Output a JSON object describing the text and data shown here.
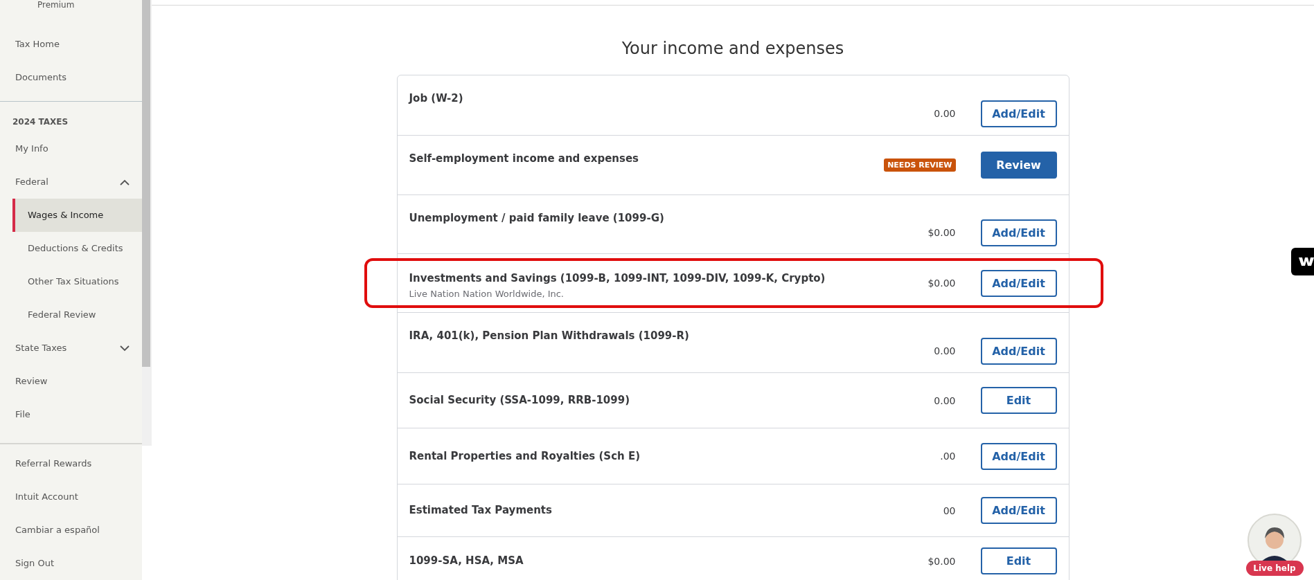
{
  "sidebar": {
    "plan": "Premium",
    "top_items": [
      {
        "label": "Tax Home",
        "selected": false
      },
      {
        "label": "Documents",
        "selected": false
      }
    ],
    "section_heading": "2024 TAXES",
    "items": [
      {
        "label": "My Info",
        "selected": false
      },
      {
        "label": "Federal",
        "selected": false,
        "expanded": true,
        "children": [
          {
            "label": "Wages & Income",
            "selected": true
          },
          {
            "label": "Deductions & Credits",
            "selected": false
          },
          {
            "label": "Other Tax Situations",
            "selected": false
          },
          {
            "label": "Federal Review",
            "selected": false
          }
        ]
      },
      {
        "label": "State Taxes",
        "selected": false,
        "expanded": false
      },
      {
        "label": "Review",
        "selected": false
      },
      {
        "label": "File",
        "selected": false
      }
    ],
    "footer_items": [
      {
        "label": "Referral Rewards"
      },
      {
        "label": "Intuit Account"
      },
      {
        "label": "Cambiar a español"
      },
      {
        "label": "Sign Out"
      }
    ]
  },
  "page_title": "Your income and expenses",
  "rows": [
    {
      "title": "Job (W-2)",
      "amount": "0.00",
      "button": {
        "label": "Add/Edit",
        "kind": "outline"
      }
    },
    {
      "title": "Self-employment income and expenses",
      "badge": "NEEDS REVIEW",
      "button": {
        "label": "Review",
        "kind": "primary"
      }
    },
    {
      "title": "Unemployment / paid family leave (1099-G)",
      "amount": "$0.00",
      "button": {
        "label": "Add/Edit",
        "kind": "outline"
      }
    },
    {
      "title": "Investments and Savings (1099-B, 1099-INT, 1099-DIV, 1099-K, Crypto)",
      "subtitle": "Live Nation Nation Worldwide, Inc.",
      "amount": "$0.00",
      "button": {
        "label": "Add/Edit",
        "kind": "outline"
      },
      "highlighted": true
    },
    {
      "title": "IRA, 401(k), Pension Plan Withdrawals (1099-R)",
      "amount": "0.00",
      "button": {
        "label": "Add/Edit",
        "kind": "outline"
      }
    },
    {
      "title": "Social Security (SSA-1099, RRB-1099)",
      "amount": "0.00",
      "button": {
        "label": "Edit",
        "kind": "outline"
      }
    },
    {
      "title": "Rental Properties and Royalties (Sch E)",
      "amount": ".00",
      "button": {
        "label": "Add/Edit",
        "kind": "outline"
      }
    },
    {
      "title": "Estimated Tax Payments",
      "amount": "00",
      "button": {
        "label": "Add/Edit",
        "kind": "outline"
      }
    },
    {
      "title": "1099-SA, HSA, MSA",
      "amount": "$0.00",
      "button": {
        "label": "Edit",
        "kind": "outline"
      }
    }
  ],
  "live_help": {
    "label": "Live help"
  }
}
